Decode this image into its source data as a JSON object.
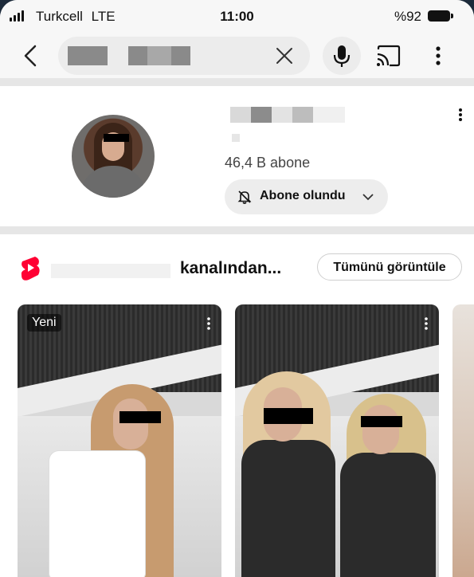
{
  "status_bar": {
    "carrier": "Turkcell",
    "network": "LTE",
    "time": "11:00",
    "battery": "%92"
  },
  "search_bar": {
    "query": ""
  },
  "channel": {
    "subscribers": "46,4 B abone",
    "subscribe_button": "Abone olundu"
  },
  "shorts_shelf": {
    "title": "kanalından...",
    "see_all": "Tümünü görüntüle",
    "cards": [
      {
        "badge": "Yeni"
      },
      {
        "badge": ""
      }
    ]
  },
  "colors": {
    "shorts_red": "#ff0033",
    "background": "#ffffff",
    "chip": "#ececec"
  },
  "icons": [
    "back-arrow-icon",
    "clear-icon",
    "mic-icon",
    "cast-icon",
    "more-vert-icon",
    "bell-off-icon",
    "chevron-down-icon",
    "youtube-shorts-icon"
  ]
}
